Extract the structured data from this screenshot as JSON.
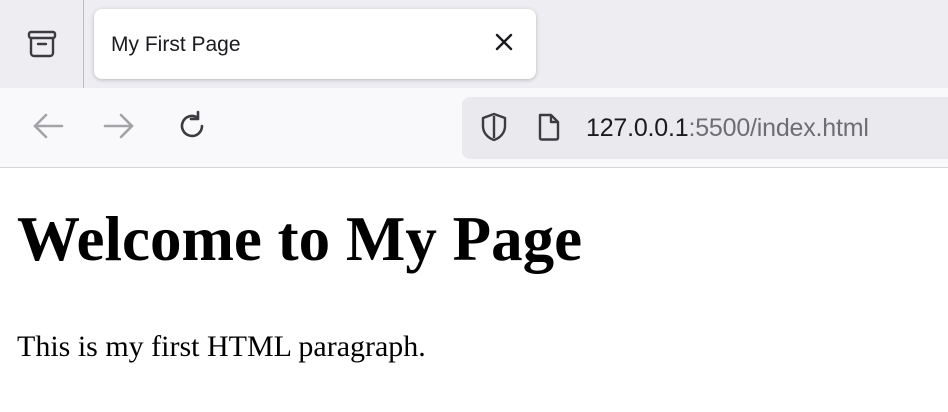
{
  "browser": {
    "tab": {
      "title": "My First Page"
    },
    "address_bar": {
      "host": "127.0.0.1",
      "rest": ":5500/index.html"
    },
    "icons": {
      "tab_manager": "tab-manager-icon",
      "close": "close-icon",
      "back": "back-arrow-icon",
      "forward": "forward-arrow-icon",
      "reload": "reload-icon",
      "shield": "shield-icon",
      "page": "page-icon"
    },
    "colors": {
      "tabstrip_bg": "#ededf2",
      "toolbar_bg": "#f9f9fb",
      "urlbar_bg": "#eaeaee",
      "icon_active": "#3b3b40",
      "icon_disabled": "#a3a3a8"
    }
  },
  "page": {
    "heading": "Welcome to My Page",
    "paragraph": "This is my first HTML paragraph."
  }
}
